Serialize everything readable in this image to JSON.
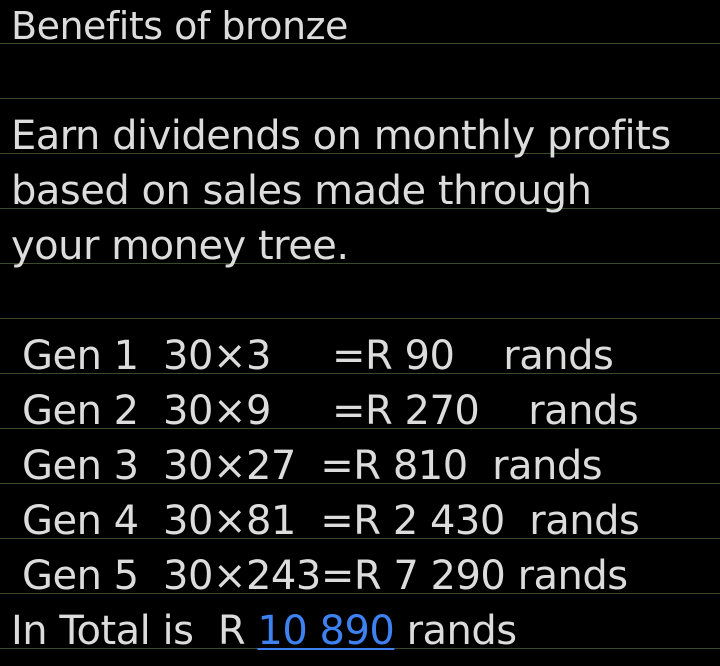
{
  "title": "Benefits of bronze",
  "description": [
    "Earn dividends on monthly profits",
    "based on sales made through",
    "your money tree."
  ],
  "generations": [
    "Gen 1  30×3     =R 90    rands",
    "Gen 2  30×9     =R 270    rands",
    "Gen 3  30×27  =R 810  rands",
    "Gen 4  30×81  =R 2 430  rands",
    "Gen 5  30×243=R 7 290 rands"
  ],
  "total": {
    "prefix": "In Total is  R ",
    "amount": "10 890",
    "suffix": " rands"
  },
  "colors": {
    "background": "#000000",
    "text": "#dcdcdc",
    "rule": "#3c4a2a",
    "link": "#3d82f0"
  }
}
